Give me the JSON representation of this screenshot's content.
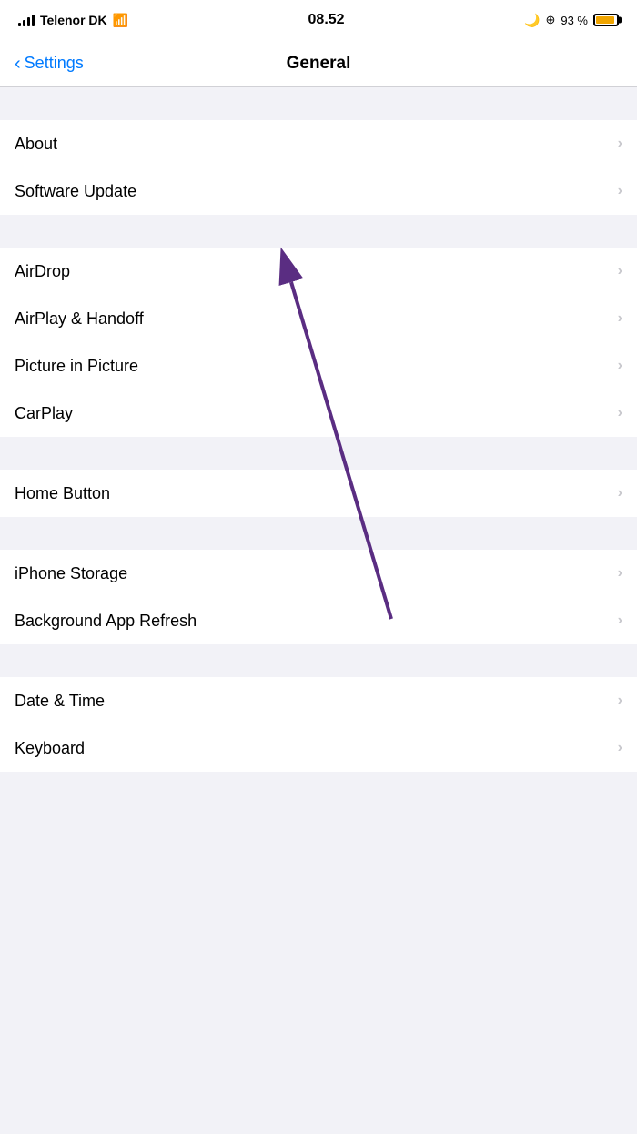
{
  "statusBar": {
    "carrier": "Telenor DK",
    "time": "08.52",
    "battery_pct": "93 %"
  },
  "navBar": {
    "backLabel": "Settings",
    "title": "General"
  },
  "groups": [
    {
      "id": "group1",
      "items": [
        {
          "label": "About"
        },
        {
          "label": "Software Update"
        }
      ]
    },
    {
      "id": "group2",
      "items": [
        {
          "label": "AirDrop"
        },
        {
          "label": "AirPlay & Handoff"
        },
        {
          "label": "Picture in Picture"
        },
        {
          "label": "CarPlay"
        }
      ]
    },
    {
      "id": "group3",
      "items": [
        {
          "label": "Home Button"
        }
      ]
    },
    {
      "id": "group4",
      "items": [
        {
          "label": "iPhone Storage"
        },
        {
          "label": "Background App Refresh"
        }
      ]
    },
    {
      "id": "group5",
      "items": [
        {
          "label": "Date & Time"
        },
        {
          "label": "Keyboard"
        }
      ]
    }
  ]
}
